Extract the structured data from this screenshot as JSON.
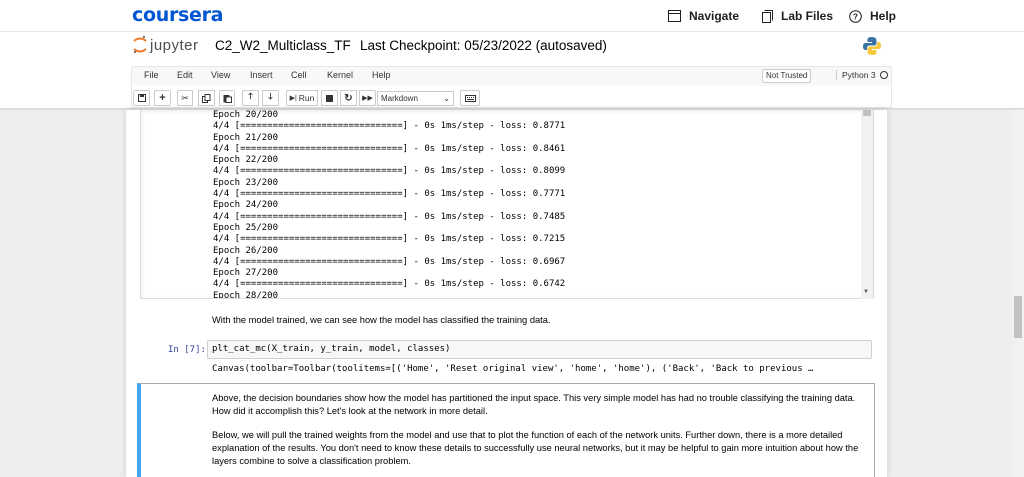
{
  "coursera": {
    "logo": "coursera",
    "nav": [
      {
        "label": "Navigate",
        "icon": "navigate-icon"
      },
      {
        "label": "Lab Files",
        "icon": "lab-files-icon"
      },
      {
        "label": "Help",
        "icon": "help-icon"
      }
    ]
  },
  "jupyter": {
    "logo_text": "jupyter",
    "notebook_name": "C2_W2_Multiclass_TF",
    "checkpoint": "Last Checkpoint: 05/23/2022  (autosaved)",
    "menu": [
      "File",
      "Edit",
      "View",
      "Insert",
      "Cell",
      "Kernel",
      "Help"
    ],
    "trust": "Not Trusted",
    "kernel": "Python 3",
    "toolbar": {
      "run_label": "Run",
      "cell_type": "Markdown"
    }
  },
  "output_lines": [
    "Epoch 20/200",
    "4/4 [==============================] - 0s 1ms/step - loss: 0.8771",
    "Epoch 21/200",
    "4/4 [==============================] - 0s 1ms/step - loss: 0.8461",
    "Epoch 22/200",
    "4/4 [==============================] - 0s 1ms/step - loss: 0.8099",
    "Epoch 23/200",
    "4/4 [==============================] - 0s 1ms/step - loss: 0.7771",
    "Epoch 24/200",
    "4/4 [==============================] - 0s 1ms/step - loss: 0.7485",
    "Epoch 25/200",
    "4/4 [==============================] - 0s 1ms/step - loss: 0.7215",
    "Epoch 26/200",
    "4/4 [==============================] - 0s 1ms/step - loss: 0.6967",
    "Epoch 27/200",
    "4/4 [==============================] - 0s 1ms/step - loss: 0.6742",
    "Epoch 28/200"
  ],
  "cells": {
    "md1": "With the model trained, we can see how the model has classified the training data.",
    "prompt": "In [7]:",
    "code": "plt_cat_mc(X_train, y_train, model, classes)",
    "output": "Canvas(toolbar=Toolbar(toolitems=[('Home', 'Reset original view', 'home', 'home'), ('Back', 'Back to previous …",
    "md2_line1": "Above, the decision boundaries show how the model has partitioned the input space. This very simple model has had no trouble classifying the training data.",
    "md2_line2": "How did it accomplish this? Let's look at the network in more detail.",
    "md3_line1": "Below, we will pull the trained weights from the model and use that to plot the function of each of the network units. Further down, there is a more detailed",
    "md3_line2": "explanation of the results. You don't need to know these details to successfully use neural networks, but it may be helpful to gain more intuition about how the",
    "md3_line3": "layers combine to solve a classification problem."
  }
}
